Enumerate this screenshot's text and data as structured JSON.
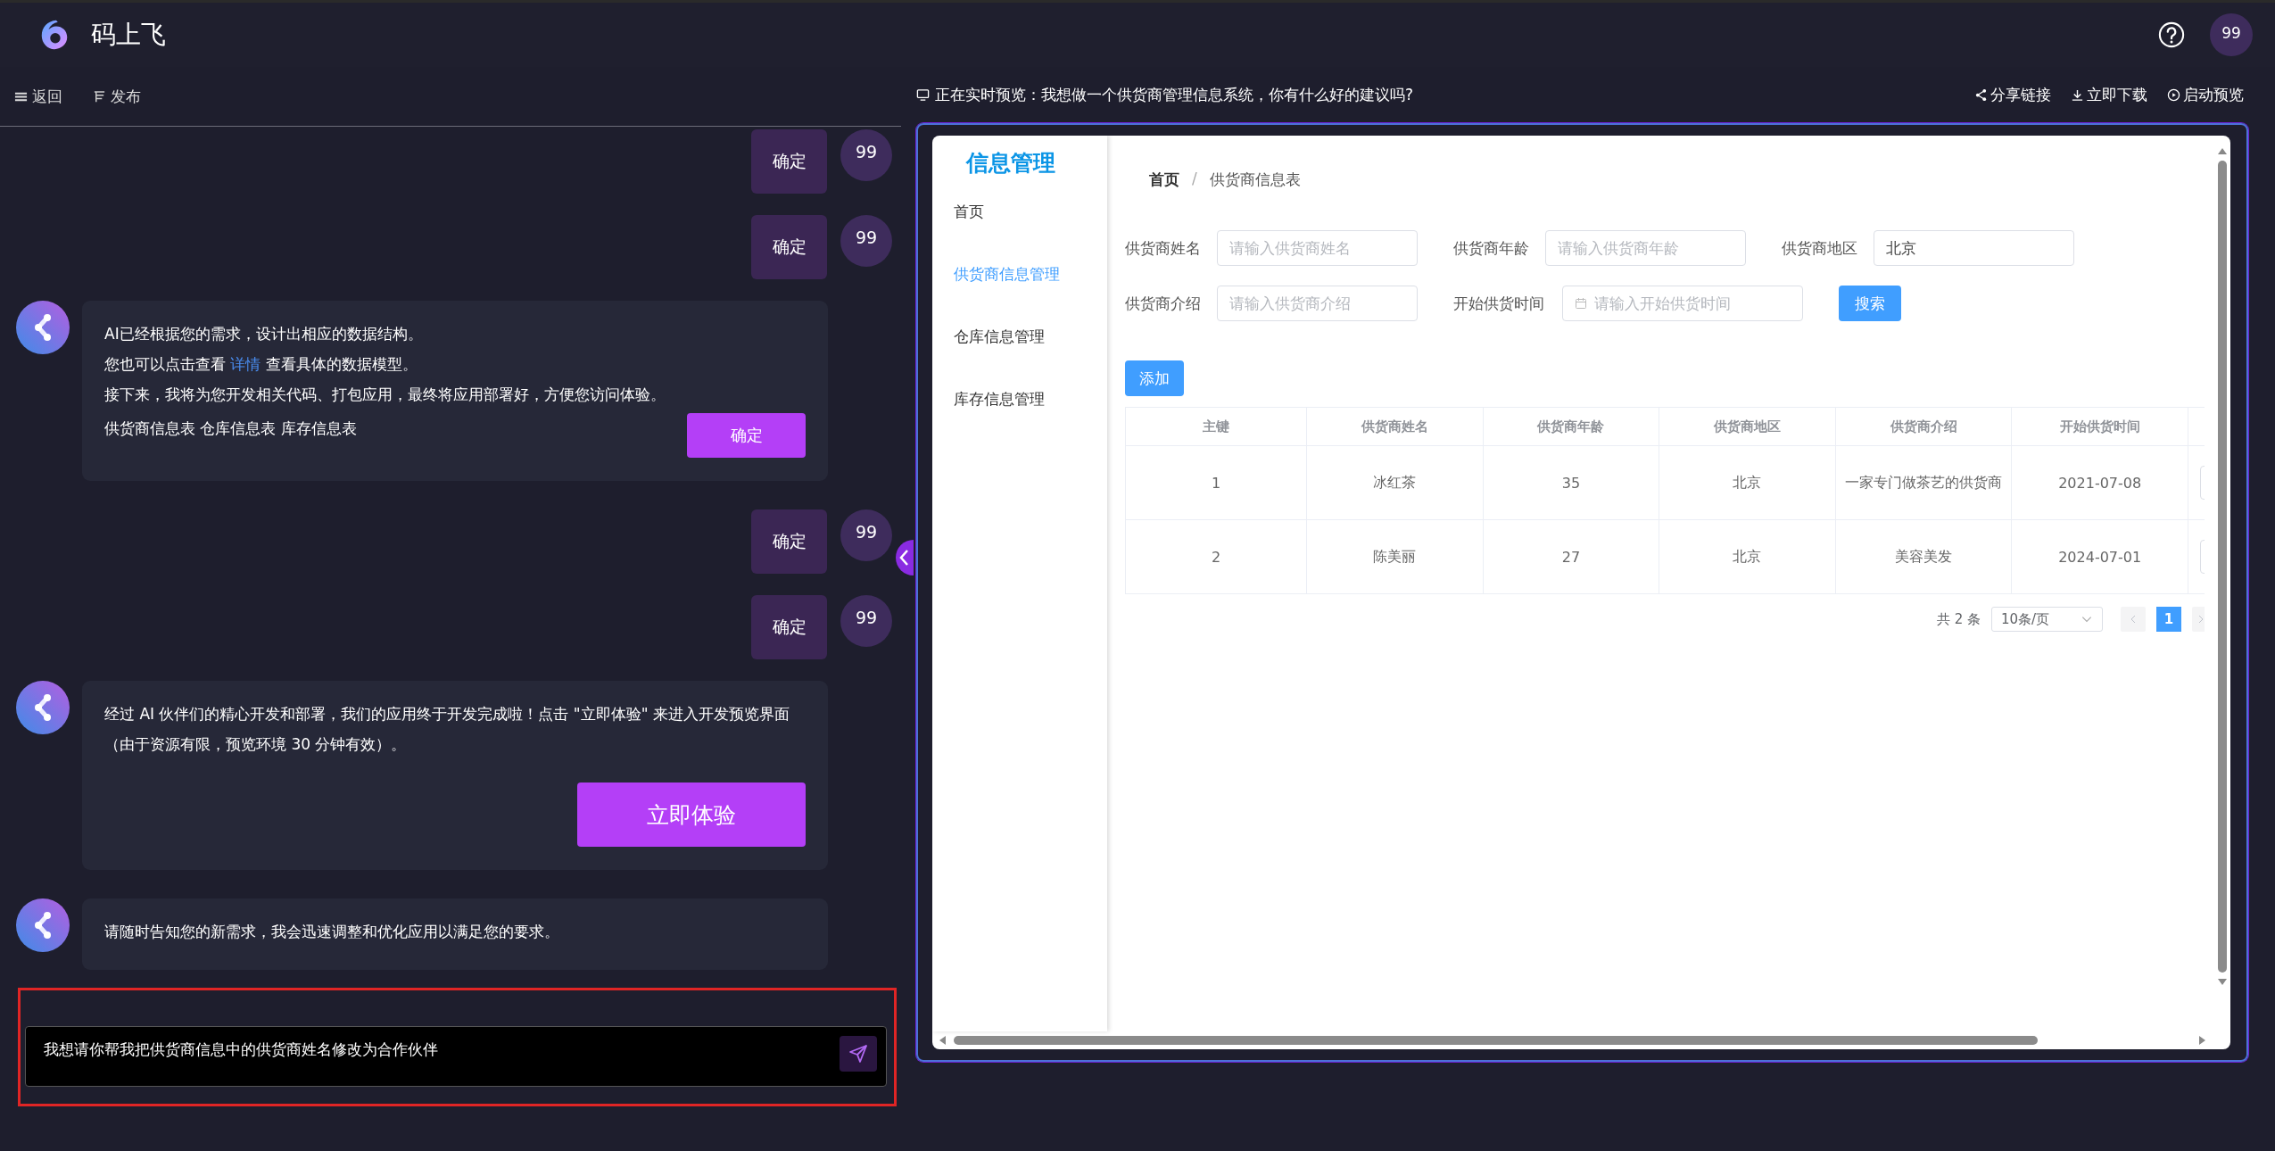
{
  "header": {
    "title": "码上飞",
    "avatar": "99"
  },
  "toolbar": [
    {
      "kind": "menu",
      "label": "返回"
    },
    {
      "kind": "publish",
      "label": "发布"
    }
  ],
  "messages": [
    {
      "kind": "user",
      "text": "确定",
      "avatar": "99"
    },
    {
      "kind": "user",
      "text": "确定",
      "avatar": "99"
    },
    {
      "kind": "ai",
      "lines": [
        {
          "text": "AI已经根据您的需求，设计出相应的数据结构。"
        },
        {
          "before": "您也可以点击查看 ",
          "link": "详情",
          "after": " 查看具体的数据模型。"
        },
        {
          "text": "接下来，我将为您开发相关代码、打包应用，最终将应用部署好，方便您访问体验。"
        }
      ],
      "footer": "供货商信息表 仓库信息表 库存信息表",
      "button": "确定"
    },
    {
      "kind": "user",
      "text": "确定",
      "avatar": "99"
    },
    {
      "kind": "user",
      "text": "确定",
      "avatar": "99"
    },
    {
      "kind": "ai",
      "lines": [
        {
          "text": "经过 AI 伙伴们的精心开发和部署，我们的应用终于开发完成啦！点击 \"立即体验\" 来进入开发预览界面（由于资源有限，预览环境 30 分钟有效）。"
        }
      ],
      "button": "立即体验"
    },
    {
      "kind": "ai",
      "lines": [
        {
          "text": "请随时告知您的新需求，我会迅速调整和优化应用以满足您的要求。"
        }
      ]
    }
  ],
  "chat_input": {
    "value": "我想请你帮我把供货商信息中的供货商姓名修改为合作伙伴",
    "highlighted": true
  },
  "preview": {
    "title": "正在实时预览：我想做一个供货商管理信息系统，你有什么好的建议吗?",
    "actions": [
      {
        "kind": "share",
        "label": "分享链接"
      },
      {
        "kind": "download",
        "label": "立即下载"
      },
      {
        "kind": "play",
        "label": "启动预览"
      }
    ],
    "app": {
      "brand": "信息管理",
      "menu": [
        {
          "label": "首页",
          "selected": false
        },
        {
          "label": "供货商信息管理",
          "selected": true
        },
        {
          "label": "仓库信息管理",
          "selected": false
        },
        {
          "label": "库存信息管理",
          "selected": false
        }
      ],
      "breadcrumb": [
        "首页",
        "供货商信息表"
      ],
      "breadcrumb_separator": "/",
      "filters": [
        {
          "kind": "text",
          "label": "供货商姓名",
          "placeholder": "请输入供货商姓名"
        },
        {
          "kind": "text",
          "label": "供货商年龄",
          "placeholder": "请输入供货商年龄"
        },
        {
          "kind": "text",
          "label": "供货商地区",
          "value": "北京"
        },
        {
          "kind": "text",
          "label": "供货商介绍",
          "placeholder": "请输入供货商介绍"
        },
        {
          "kind": "date",
          "label": "开始供货时间",
          "placeholder": "请输入开始供货时间"
        }
      ],
      "search_button": "搜索",
      "add_button": "添加",
      "table": {
        "columns": [
          "主键",
          "供货商姓名",
          "供货商年龄",
          "供货商地区",
          "供货商介绍",
          "开始供货时间"
        ],
        "rows": [
          [
            "1",
            "冰红茶",
            "35",
            "北京",
            "一家专门做茶艺的供货商",
            "2021-07-08"
          ],
          [
            "2",
            "陈美丽",
            "27",
            "北京",
            "美容美发",
            "2024-07-01"
          ]
        ]
      },
      "pagination": {
        "total": "共 2 条",
        "page_size": "10条/页",
        "pages": [
          {
            "label": "1",
            "selected": true
          }
        ]
      }
    }
  }
}
